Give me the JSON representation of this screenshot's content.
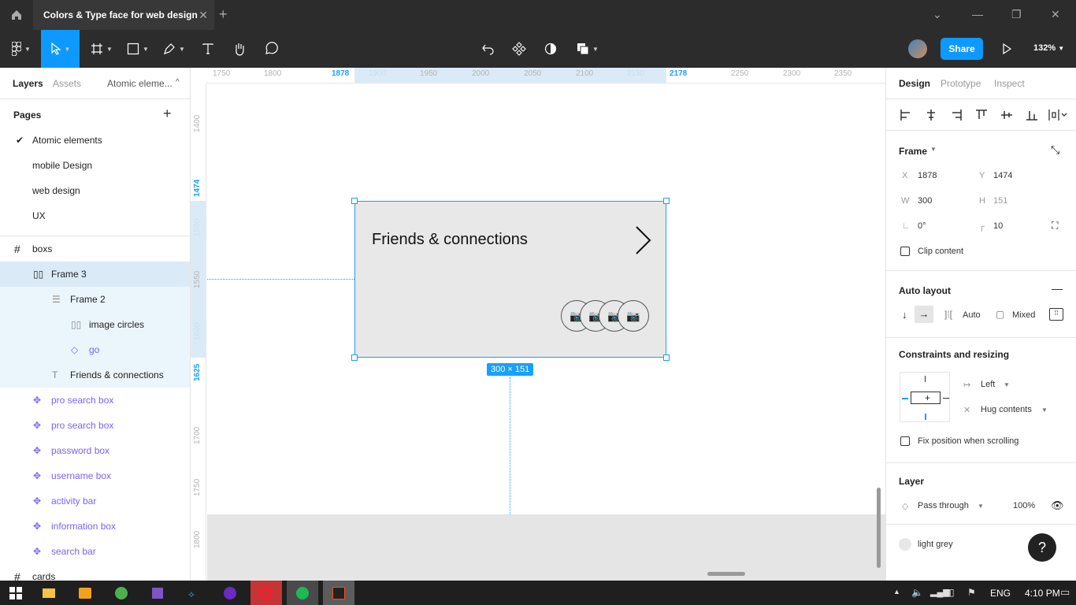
{
  "titlebar": {
    "tab_title": "Colors & Type face for web design",
    "close": "✕",
    "new_tab": "+"
  },
  "toolbar": {
    "share_label": "Share",
    "zoom": "132%"
  },
  "left": {
    "tabs": {
      "layers": "Layers",
      "assets": "Assets",
      "page": "Atomic eleme..."
    },
    "pages_heading": "Pages",
    "pages": [
      "Atomic elements",
      "mobile Design",
      "web design",
      "UX"
    ],
    "layers": [
      {
        "label": "boxs"
      },
      {
        "label": "Frame 3"
      },
      {
        "label": "Frame 2"
      },
      {
        "label": "image circles"
      },
      {
        "label": "go"
      },
      {
        "label": "Friends & connections"
      },
      {
        "label": "pro search box"
      },
      {
        "label": "pro search box"
      },
      {
        "label": "password box"
      },
      {
        "label": "username box"
      },
      {
        "label": "activity bar"
      },
      {
        "label": "information box"
      },
      {
        "label": "search bar"
      },
      {
        "label": "cards"
      }
    ]
  },
  "canvas": {
    "hticks": [
      "1750",
      "1800",
      "1878",
      "1900",
      "1950",
      "2000",
      "2050",
      "2100",
      "2150",
      "2178",
      "2250",
      "2300",
      "2350"
    ],
    "vticks": [
      "1400",
      "1474",
      "1500",
      "1550",
      "1600",
      "1625",
      "1700",
      "1750",
      "1800"
    ],
    "frame_title": "Friends & connections",
    "size_badge": "300 × 151"
  },
  "right": {
    "tabs": {
      "design": "Design",
      "prototype": "Prototype",
      "inspect": "Inspect"
    },
    "frame_heading": "Frame",
    "x_label": "X",
    "x": "1878",
    "y_label": "Y",
    "y": "1474",
    "w_label": "W",
    "w": "300",
    "h_label": "H",
    "h": "151",
    "rotation": "0°",
    "radius": "10",
    "clip_content": "Clip content",
    "auto_layout": "Auto layout",
    "auto": "Auto",
    "mixed": "Mixed",
    "constraints": "Constraints and resizing",
    "left_constraint": "Left",
    "hug": "Hug contents",
    "fix_position": "Fix position when scrolling",
    "layer": "Layer",
    "pass_through": "Pass through",
    "opacity": "100%",
    "fill_name": "light grey"
  },
  "taskbar": {
    "lang": "ENG",
    "time": "4:10 PM"
  },
  "help": "?"
}
